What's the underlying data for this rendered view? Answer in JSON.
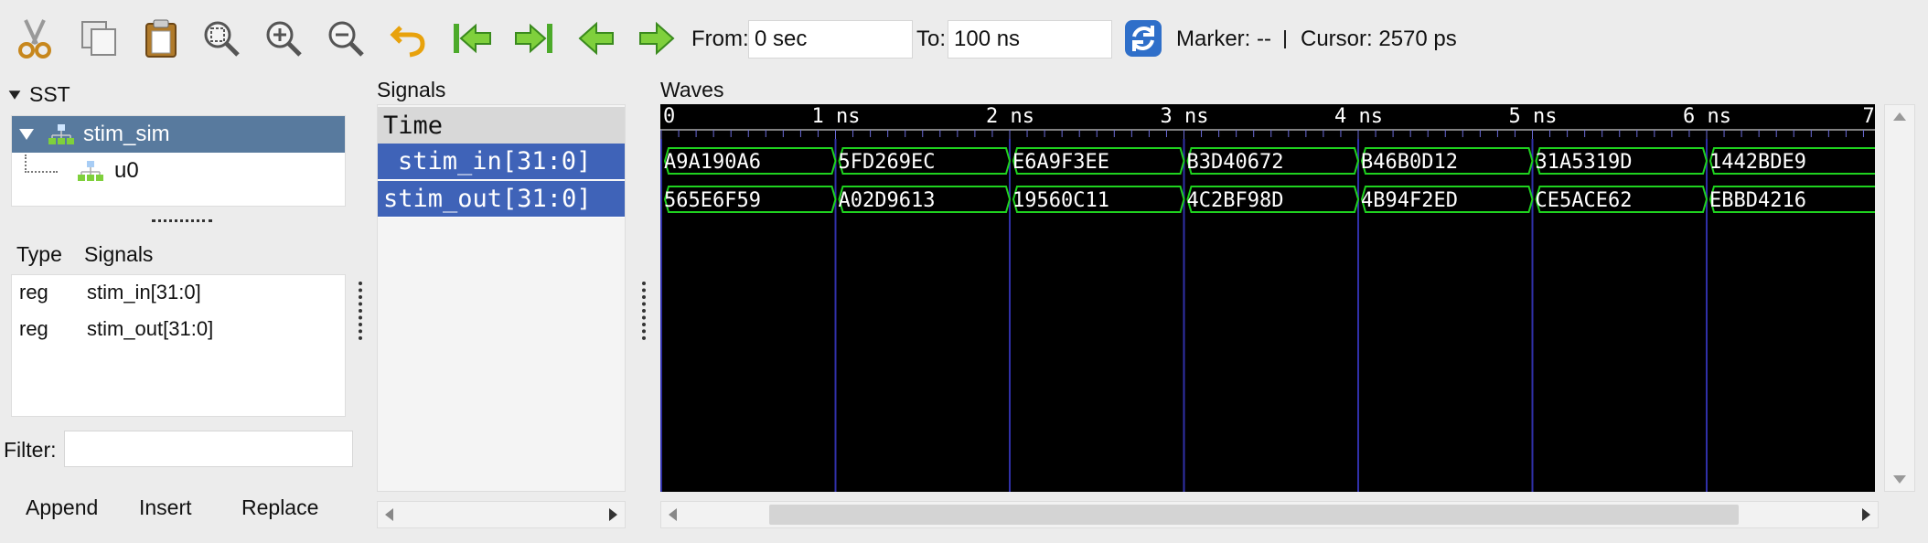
{
  "toolbar": {
    "icons": [
      "cut-icon",
      "copy-icon",
      "paste-icon",
      "zoom-fit-icon",
      "zoom-in-icon",
      "zoom-out-icon",
      "undo-zoom-icon",
      "zoom-to-start-icon",
      "zoom-to-end-icon",
      "find-previous-edge-icon",
      "find-next-edge-icon",
      "reload-icon"
    ],
    "from_label": "From:",
    "from_value": "0 sec",
    "to_label": "To:",
    "to_value": "100 ns",
    "marker_text": "Marker: --",
    "cursor_text": "Cursor: 2570 ps"
  },
  "sst": {
    "title": "SST",
    "tree": [
      {
        "label": "stim_sim",
        "selected": true
      },
      {
        "label": "u0",
        "selected": false
      }
    ],
    "type_header": "Type",
    "signals_header": "Signals",
    "rows": [
      {
        "type": "reg",
        "name": "stim_in[31:0]"
      },
      {
        "type": "reg",
        "name": "stim_out[31:0]"
      }
    ],
    "filter_label": "Filter:",
    "filter_value": "",
    "buttons": [
      "Append",
      "Insert",
      "Replace"
    ]
  },
  "signals_pane": {
    "title": "Signals",
    "header": "Time",
    "rows": [
      "stim_in[31:0]",
      "stim_out[31:0]"
    ]
  },
  "waves": {
    "title": "Waves",
    "timeline_labels": [
      "0",
      "1 ns",
      "2 ns",
      "3 ns",
      "4 ns",
      "5 ns",
      "6 ns",
      "7"
    ],
    "traces": [
      {
        "name": "stim_in[31:0]",
        "values": [
          "A9A190A6",
          "5FD269EC",
          "E6A9F3EE",
          "B3D40672",
          "B46B0D12",
          "31A5319D",
          "1442BDE9"
        ]
      },
      {
        "name": "stim_out[31:0]",
        "values": [
          "565E6F59",
          "A02D9613",
          "19560C11",
          "4C2BF98D",
          "4B94F2ED",
          "CE5ACE62",
          "EBBD4216"
        ]
      }
    ],
    "colors": {
      "background": "#000000",
      "trace": "#1fd21f",
      "ruler": "#ffffff",
      "gridline": "#3030a8",
      "text": "#ffffff"
    }
  },
  "colors": {
    "selection": "#3f63b8",
    "tree_selection": "#587a9e",
    "window": "#ececec"
  }
}
